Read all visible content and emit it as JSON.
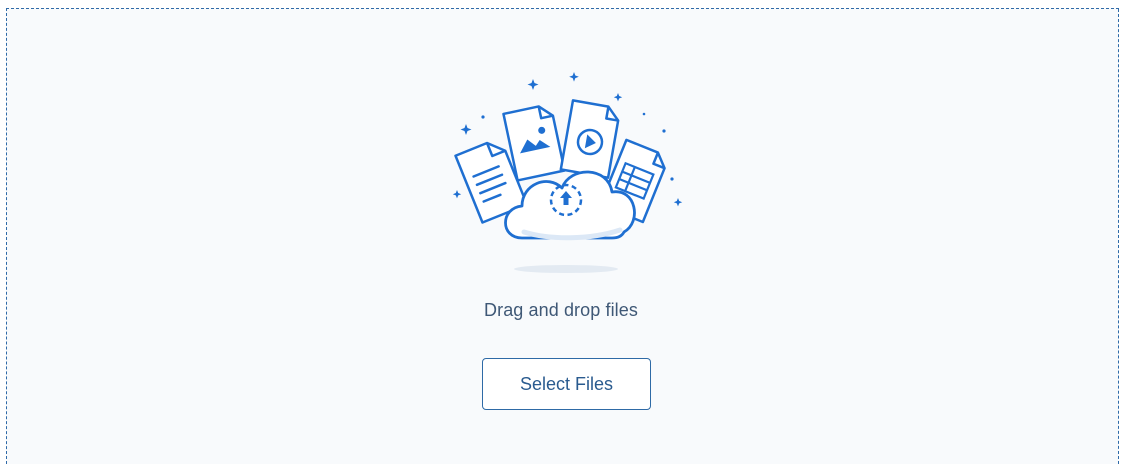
{
  "dropzone": {
    "prompt_text": "Drag and drop files",
    "select_button_label": "Select Files",
    "illustration_icon": "cloud-upload-with-files-icon"
  },
  "colors": {
    "accent": "#1f6fd1",
    "border": "#2f6aa8",
    "text": "#3f5876",
    "background": "#f8fafc"
  }
}
